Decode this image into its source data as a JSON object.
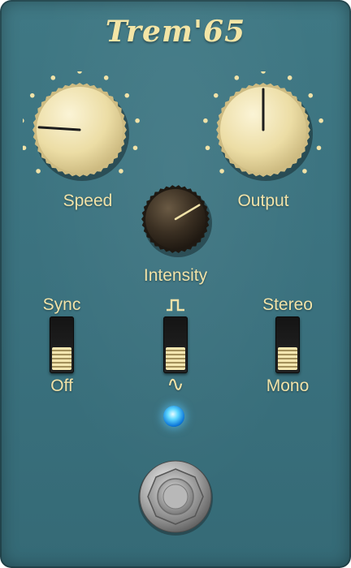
{
  "pedal": {
    "title": "Trem'65",
    "accent_color": "#f0e2a8",
    "body_color": "#3a717e"
  },
  "knobs": {
    "speed": {
      "label": "Speed",
      "value": 0.18
    },
    "output": {
      "label": "Output",
      "value": 0.5
    },
    "intensity": {
      "label": "Intensity",
      "value": 0.72
    }
  },
  "switches": {
    "sync": {
      "top_label": "Sync",
      "bottom_label": "Off",
      "position": "down"
    },
    "waveform": {
      "top_icon": "square-wave-icon",
      "bottom_label": "∿",
      "position": "down"
    },
    "stereo": {
      "top_label": "Stereo",
      "bottom_label": "Mono",
      "position": "down"
    }
  },
  "led": {
    "state": "on",
    "color": "#3ab8ff"
  },
  "footswitch": {
    "icon": "footswitch-icon"
  }
}
